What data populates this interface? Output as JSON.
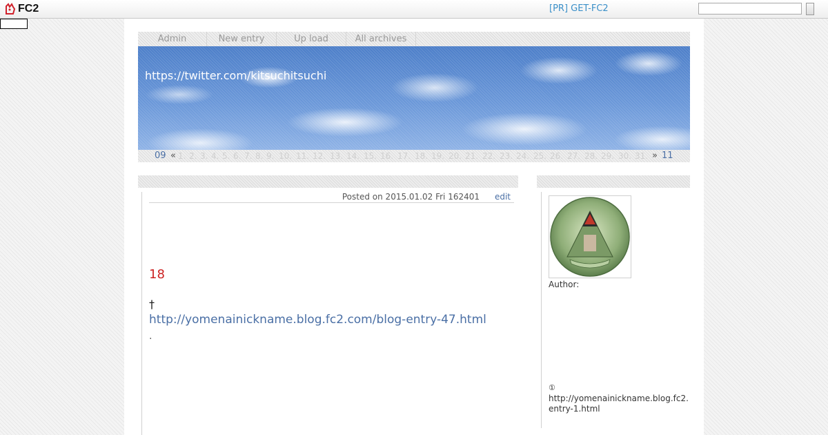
{
  "topbar": {
    "logo_text": "FC2",
    "pr_link": "[PR] GET-FC2",
    "search_placeholder": ""
  },
  "nav": {
    "items": [
      {
        "label": "Admin"
      },
      {
        "label": "New entry"
      },
      {
        "label": "Up load"
      },
      {
        "label": "All archives"
      }
    ]
  },
  "header": {
    "title": "https://twitter.com/kitsuchitsuchi"
  },
  "calendar": {
    "prev_month": "09",
    "prev_arrow": "«",
    "days": [
      "1.",
      "2.",
      "3.",
      "4.",
      "5.",
      "6.",
      "7.",
      "8.",
      "9.",
      "10.",
      "11.",
      "12.",
      "13.",
      "14.",
      "15.",
      "16.",
      "17.",
      "18.",
      "19.",
      "20.",
      "21.",
      "22.",
      "23.",
      "24.",
      "25.",
      "26.",
      "27.",
      "28.",
      "29.",
      "30.",
      "31."
    ],
    "next_arrow": "»",
    "next_month": "11"
  },
  "entry": {
    "posted": "Posted on 2015.01.02 Fri 162401",
    "edit_label": "edit",
    "number": "18",
    "dagger": "†",
    "link": "http://yomenainickname.blog.fc2.com/blog-entry-47.html",
    "period": "."
  },
  "sidebar": {
    "author_label": "Author:",
    "marker": "①",
    "url": "http://yomenainickname.blog.fc2.entry-1.html"
  },
  "colors": {
    "link": "#4a6fa5",
    "accent_red": "#cc2222",
    "pr_blue": "#3a8fc8"
  }
}
